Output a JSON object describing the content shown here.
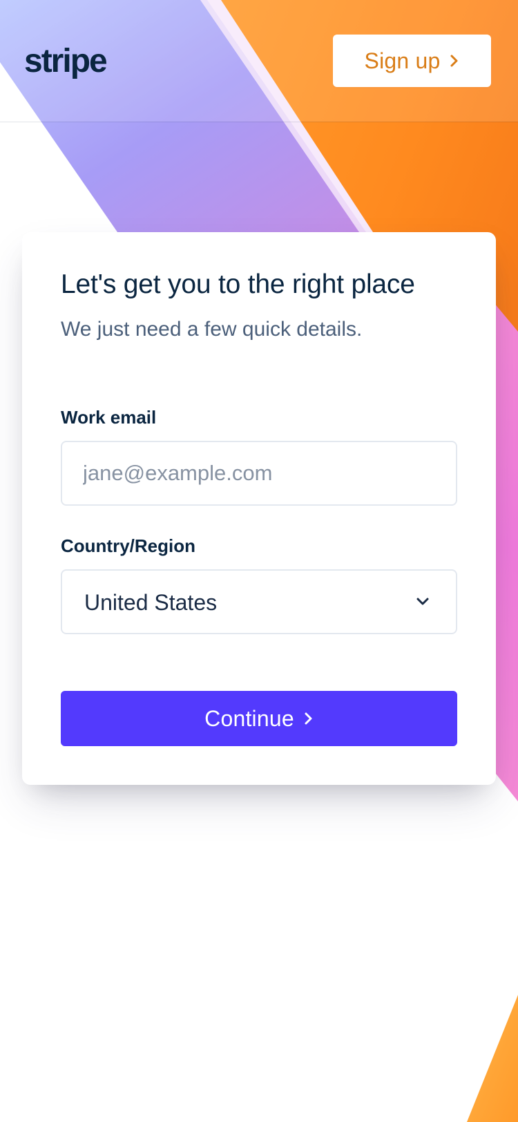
{
  "header": {
    "logo_text": "stripe",
    "signup_label": "Sign up"
  },
  "card": {
    "title": "Let's get you to the right place",
    "subtitle": "We just need a few quick details.",
    "email": {
      "label": "Work email",
      "value": "",
      "placeholder": "jane@example.com"
    },
    "country": {
      "label": "Country/Region",
      "selected": "United States"
    },
    "continue_label": "Continue"
  },
  "colors": {
    "brand_primary": "#533afd",
    "signup_text": "#d97d17",
    "heading": "#0a2540",
    "subtext": "#4b5f7a",
    "placeholder": "#8792a2"
  },
  "icons": {
    "signup_chevron": "chevron-right-icon",
    "select_chevron": "chevron-down-icon",
    "continue_chevron": "chevron-right-icon"
  }
}
